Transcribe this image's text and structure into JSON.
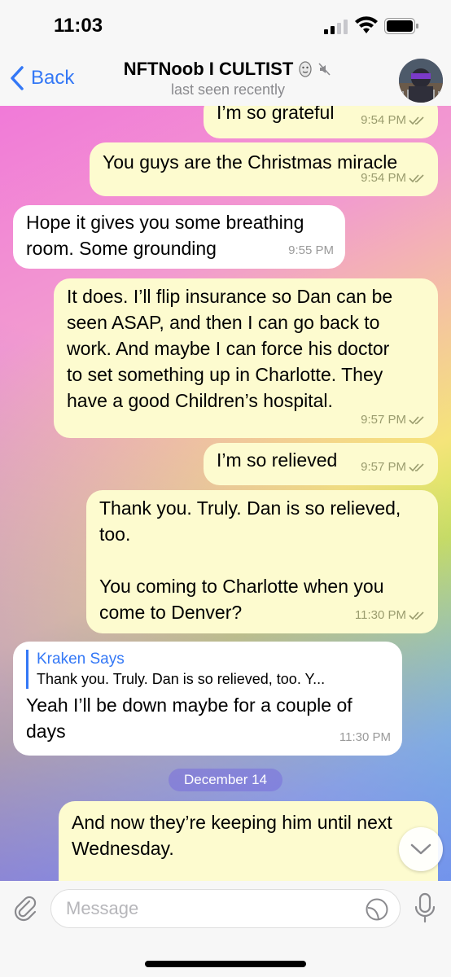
{
  "status": {
    "time": "11:03"
  },
  "header": {
    "back_label": "Back",
    "title": "NFTNoob I CULTIST",
    "subtitle": "last seen recently"
  },
  "messages": [
    {
      "text": "I’m so grateful",
      "time": "9:54 PM"
    },
    {
      "text": "You guys are the Christmas miracle",
      "time": "9:54 PM"
    },
    {
      "line1": "Hope it gives you some breathing",
      "line2": "room. Some grounding",
      "time": "9:55 PM"
    },
    {
      "lines": [
        "It does. I’ll flip insurance so Dan can be",
        "seen ASAP, and then I can go back to",
        "work. And maybe I can force his doctor",
        "to set something up in Charlotte. They",
        "have a good Children’s hospital."
      ],
      "time": "9:57 PM"
    },
    {
      "text": "I’m so relieved",
      "time": "9:57 PM"
    },
    {
      "lines": [
        "Thank you. Truly. Dan is so relieved,",
        "too.",
        "",
        "You coming to Charlotte when you",
        "come to Denver?"
      ],
      "time": "11:30 PM"
    },
    {
      "reply_name": "Kraken Says",
      "reply_text": "Thank you. Truly. Dan is so relieved, too.   Y...",
      "lines": [
        "Yeah I’ll be down maybe for a couple of",
        "days"
      ],
      "time": "11:30 PM"
    },
    {
      "lines": [
        "And now they’re keeping him until next",
        "Wednesday."
      ]
    }
  ],
  "date_separator": "December 14",
  "composer": {
    "placeholder": "Message"
  }
}
